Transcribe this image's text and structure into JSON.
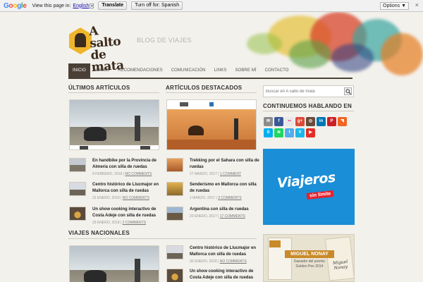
{
  "translate_bar": {
    "google_letters": [
      "G",
      "o",
      "o",
      "g",
      "l",
      "e"
    ],
    "view_text": "View this page in:",
    "language": "English",
    "translate_button": "Translate",
    "turn_off_button": "Turn off for: Spanish",
    "options": "Options ▼",
    "close": "×"
  },
  "site": {
    "logo_text_1": "A salto",
    "logo_text_2": "de mata",
    "tagline": "BLOG DE VIAJES"
  },
  "nav": [
    "INICIO",
    "VIAJES",
    "RECOMENDACIONES",
    "COMUNICACIÓN",
    "LINKS",
    "SOBRE MÍ",
    "CONTACTO"
  ],
  "latest": {
    "title": "ÚLTIMOS ARTÍCULOS",
    "posts": [
      {
        "title": "En handbike por la Provincia de Almería con silla de ruedas",
        "date": "9 FEBRERO, 2018",
        "comments": "NO COMMENTS"
      },
      {
        "title": "Centro histórico de Llucmajor en Mallorca con silla de ruedas",
        "date": "31 ENERO, 2018",
        "comments": "NO COMMENTS"
      },
      {
        "title": "Un show cooking interactivo de Costa Adeje con silla de ruedas",
        "date": "29 ENERO, 2018",
        "comments": "2 COMMENTS"
      }
    ]
  },
  "featured": {
    "title": "ARTÍCULOS DESTACADOS",
    "posts": [
      {
        "title": "Trekking por el Sahara con silla de ruedas",
        "date": "27 MARZO, 2017",
        "comments": "1 COMMENT"
      },
      {
        "title": "Senderismo en Mallorca con silla de ruedas",
        "date": "1 MARZO, 2017",
        "comments": "3 COMMENTS"
      },
      {
        "title": "Argentina con silla de ruedas",
        "date": "20 ENERO, 2017",
        "comments": "17 COMMENTS"
      }
    ]
  },
  "national": {
    "title": "VIAJES NACIONALES",
    "posts": [
      {
        "title": "Centro histórico de Llucmajor en Mallorca con silla de ruedas",
        "date": "30 ENERO, 2018",
        "comments": "NO COMMENTS"
      },
      {
        "title": "Un show cooking interactivo de Costa Adeje con silla de ruedas",
        "date": "",
        "comments": ""
      }
    ]
  },
  "sidebar": {
    "search_placeholder": "Buscar en A salto de mata",
    "social_title": "CONTINUEMOS HABLANDO EN",
    "social_icons": [
      {
        "name": "email-icon",
        "color": "#8c8c8c",
        "glyph": "✉"
      },
      {
        "name": "facebook-icon",
        "color": "#3b5998",
        "glyph": "f"
      },
      {
        "name": "flickr-icon",
        "color": "#e9e9e9",
        "glyph": "••"
      },
      {
        "name": "google-plus-icon",
        "color": "#dd4b39",
        "glyph": "g+"
      },
      {
        "name": "instagram-icon",
        "color": "#6b4b3a",
        "glyph": "◎"
      },
      {
        "name": "linkedin-icon",
        "color": "#0077b5",
        "glyph": "in"
      },
      {
        "name": "pinterest-icon",
        "color": "#cb2027",
        "glyph": "P"
      },
      {
        "name": "rss-icon",
        "color": "#f26522",
        "glyph": "◥"
      },
      {
        "name": "skype-icon",
        "color": "#00aff0",
        "glyph": "S"
      },
      {
        "name": "spotify-icon",
        "color": "#1ed760",
        "glyph": "≋"
      },
      {
        "name": "twitter-icon",
        "color": "#55acee",
        "glyph": "t"
      },
      {
        "name": "vimeo-icon",
        "color": "#1ab7ea",
        "glyph": "V"
      },
      {
        "name": "youtube-icon",
        "color": "#e52d27",
        "glyph": "▶"
      }
    ],
    "banner_title": "Viajeros",
    "banner_sub": "sin límite",
    "book_author": "MIGUEL NONAY",
    "book_caption_1": "Ganador del premio",
    "book_caption_2": "Golden Pen 2014",
    "book_cover_name": "Miguel Nonay"
  },
  "colors": {
    "nav_active": "#4a4036",
    "banner": "#1a8ed6",
    "accent_red": "#e8202a"
  }
}
